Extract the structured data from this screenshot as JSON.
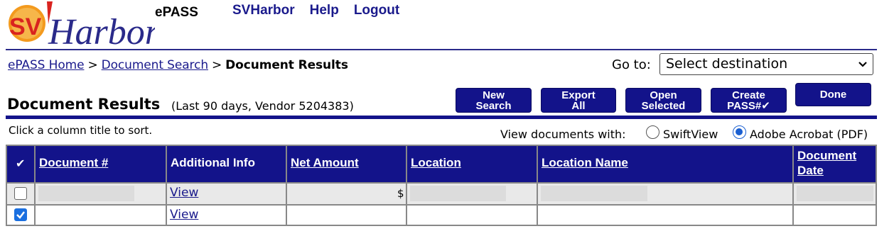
{
  "header": {
    "brand_logo_text": "SVHarbor",
    "product": "ePASS",
    "nav": [
      "SVHarbor",
      "Help",
      "Logout"
    ]
  },
  "breadcrumb": {
    "items": [
      "ePASS Home",
      "Document Search"
    ],
    "separator": ">",
    "current": "Document Results"
  },
  "goto": {
    "label": "Go to:",
    "selected": "Select destination"
  },
  "title": "Document Results",
  "subtitle": "(Last 90 days, Vendor 5204383)",
  "actions": {
    "new_search": [
      "New",
      "Search"
    ],
    "export_all": [
      "Export",
      "All"
    ],
    "open_selected": [
      "Open",
      "Selected"
    ],
    "create_pass": [
      "Create",
      "PASS#✔"
    ],
    "done": "Done"
  },
  "sort_hint": "Click a column title to sort.",
  "viewer": {
    "label": "View documents with:",
    "options": [
      "SwiftView",
      "Adobe Acrobat (PDF)"
    ],
    "selected": "Adobe Acrobat (PDF)"
  },
  "table": {
    "select_all_mark": "✔",
    "columns": [
      "Document #",
      "Additional Info",
      "Net Amount",
      "Location",
      "Location Name",
      "Document Date"
    ],
    "rows": [
      {
        "checked": false,
        "additional_info": "View",
        "net_amount": "$"
      },
      {
        "checked": true,
        "additional_info": "View",
        "net_amount": ""
      }
    ]
  },
  "colors": {
    "navy": "#13138a",
    "link": "#1a1a8c",
    "checkbox_blue": "#1a6fe0",
    "logo_red": "#d9231f",
    "logo_orange": "#f39a1e"
  }
}
